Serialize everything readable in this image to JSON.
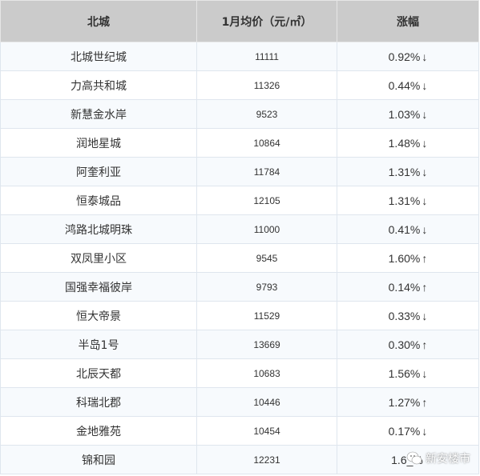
{
  "header": {
    "col1": "北城",
    "col2": "1月均价（元/㎡）",
    "col3": "涨幅"
  },
  "colors": {
    "down": "#5cb85c",
    "up": "#f06a3c",
    "header_bg": "#cbcbcb"
  },
  "rows": [
    {
      "name": "北城世纪城",
      "price": "11111",
      "change": "0.92%",
      "dir": "down",
      "arrow": "↓"
    },
    {
      "name": "力高共和城",
      "price": "11326",
      "change": "0.44%",
      "dir": "down",
      "arrow": "↓"
    },
    {
      "name": "新慧金水岸",
      "price": "9523",
      "change": "1.03%",
      "dir": "down",
      "arrow": "↓"
    },
    {
      "name": "润地星城",
      "price": "10864",
      "change": "1.48%",
      "dir": "down",
      "arrow": "↓"
    },
    {
      "name": "阿奎利亚",
      "price": "11784",
      "change": "1.31%",
      "dir": "down",
      "arrow": "↓"
    },
    {
      "name": "恒泰城品",
      "price": "12105",
      "change": "1.31%",
      "dir": "down",
      "arrow": "↓"
    },
    {
      "name": "鸿路北城明珠",
      "price": "11000",
      "change": "0.41%",
      "dir": "down",
      "arrow": "↓"
    },
    {
      "name": "双凤里小区",
      "price": "9545",
      "change": "1.60%",
      "dir": "up",
      "arrow": "↑"
    },
    {
      "name": "国强幸福彼岸",
      "price": "9793",
      "change": "0.14%",
      "dir": "up",
      "arrow": "↑"
    },
    {
      "name": "恒大帝景",
      "price": "11529",
      "change": "0.33%",
      "dir": "down",
      "arrow": "↓"
    },
    {
      "name": "半岛1号",
      "price": "13669",
      "change": "0.30%",
      "dir": "up",
      "arrow": "↑"
    },
    {
      "name": "北辰天都",
      "price": "10683",
      "change": "1.56%",
      "dir": "down",
      "arrow": "↓"
    },
    {
      "name": "科瑞北郡",
      "price": "10446",
      "change": "1.27%",
      "dir": "up",
      "arrow": "↑"
    },
    {
      "name": "金地雅苑",
      "price": "10454",
      "change": "0.17%",
      "dir": "down",
      "arrow": "↓"
    },
    {
      "name": "锦和园",
      "price": "12231",
      "change": "1.6_%",
      "dir": "down",
      "arrow": ""
    }
  ],
  "watermark": {
    "text": "新安楼市",
    "icon": "wechat-icon"
  }
}
